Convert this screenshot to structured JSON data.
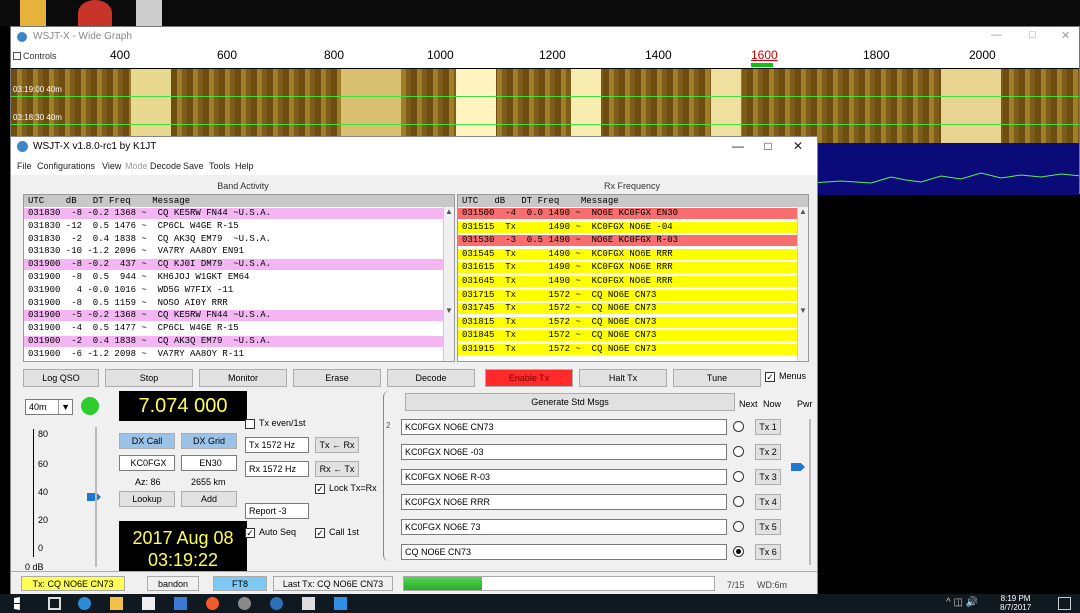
{
  "wide_graph": {
    "title": "WSJT-X - Wide Graph",
    "controls_label": "Controls",
    "scale": [
      "400",
      "600",
      "800",
      "1000",
      "1200",
      "1400",
      "1600",
      "1800",
      "2000"
    ],
    "waterfall_times": [
      "03:19:00 40m",
      "03:18:30 40m"
    ]
  },
  "main": {
    "title": "WSJT-X   v1.8.0-rc1   by K1JT",
    "menu": [
      "File",
      "Configurations",
      "View",
      "Mode",
      "Decode",
      "Save",
      "Tools",
      "Help"
    ],
    "band_activity_label": "Band Activity",
    "rx_frequency_label": "Rx Frequency",
    "band_header": "UTC    dB   DT Freq    Message",
    "rx_header": "UTC   dB   DT Freq    Message",
    "band_rows": [
      {
        "text": "031830  -8 -0.2 1368 ~  CQ KE5RW FN44 ~U.S.A.",
        "hl": "pink"
      },
      {
        "text": "031830 -12  0.5 1476 ~  CP6CL W4GE R-15",
        "hl": ""
      },
      {
        "text": "031830  -2  0.4 1838 ~  CQ AK3Q EM79  ~U.S.A.",
        "hl": ""
      },
      {
        "text": "031830 -10 -1.2 2096 ~  VA7RY AA8OY EN91",
        "hl": ""
      },
      {
        "text": "031900  -8 -0.2  437 ~  CQ KJ0I DM79  ~U.S.A.",
        "hl": "pink"
      },
      {
        "text": "031900  -8  0.5  944 ~  KH6JOJ W1GKT EM64",
        "hl": ""
      },
      {
        "text": "031900   4 -0.0 1016 ~  WD5G W7FIX -11",
        "hl": ""
      },
      {
        "text": "031900  -8  0.5 1159 ~  NOSO AI0Y RRR",
        "hl": ""
      },
      {
        "text": "031900  -5 -0.2 1368 ~  CQ KE5RW FN44 ~U.S.A.",
        "hl": "pink"
      },
      {
        "text": "031900  -4  0.5 1477 ~  CP6CL W4GE R-15",
        "hl": ""
      },
      {
        "text": "031900  -2  0.4 1838 ~  CQ AK3Q EM79  ~U.S.A.",
        "hl": "pink"
      },
      {
        "text": "031900  -6 -1.2 2098 ~  VA7RY AA8OY R-11",
        "hl": ""
      }
    ],
    "rx_rows": [
      {
        "text": "031500  -4  0.0 1490 ~  NO6E KC0FGX EN30",
        "hl": "red"
      },
      {
        "text": "031515  Tx      1490 ~  KC0FGX NO6E -04",
        "hl": "yellow"
      },
      {
        "text": "031530  -3  0.5 1490 ~  NO6E KC0FGX R-03",
        "hl": "red"
      },
      {
        "text": "031545  Tx      1490 ~  KC0FGX NO6E RRR",
        "hl": "yellow"
      },
      {
        "text": "031615  Tx      1490 ~  KC0FGX NO6E RRR",
        "hl": "yellow"
      },
      {
        "text": "031645  Tx      1490 ~  KC0FGX NO6E RRR",
        "hl": "yellow"
      },
      {
        "text": "031715  Tx      1572 ~  CQ NO6E CN73",
        "hl": "yellow"
      },
      {
        "text": "031745  Tx      1572 ~  CQ NO6E CN73",
        "hl": "yellow"
      },
      {
        "text": "031815  Tx      1572 ~  CQ NO6E CN73",
        "hl": "yellow"
      },
      {
        "text": "031845  Tx      1572 ~  CQ NO6E CN73",
        "hl": "yellow"
      },
      {
        "text": "031915  Tx      1572 ~  CQ NO6E CN73",
        "hl": "yellow"
      }
    ],
    "buttons": {
      "log_qso": "Log QSO",
      "stop": "Stop",
      "monitor": "Monitor",
      "erase": "Erase",
      "decode": "Decode",
      "enable_tx": "Enable Tx",
      "halt_tx": "Halt Tx",
      "tune": "Tune",
      "menus": "Menus"
    },
    "band_select": "40m",
    "frequency": "7.074 000",
    "db_scale": [
      "80",
      "60",
      "40",
      "20",
      "0"
    ],
    "db_label": "0 dB",
    "dx_call_btn": "DX Call",
    "dx_grid_btn": "DX Grid",
    "dx_call_val": "KC0FGX",
    "dx_grid_val": "EN30",
    "az": "Az: 86",
    "dist": "2655 km",
    "lookup": "Lookup",
    "add": "Add",
    "date": "2017 Aug 08",
    "time": "03:19:22",
    "tx_even": "Tx even/1st",
    "tx_hz": "Tx  1572  Hz",
    "rx_hz": "Rx  1572  Hz",
    "tx_from_rx": "Tx ← Rx",
    "rx_from_tx": "Rx ← Tx",
    "lock": "Lock Tx=Rx",
    "report": "Report  -3",
    "auto_seq": "Auto Seq",
    "call_1st": "Call 1st",
    "gen_msgs": "Generate Std Msgs",
    "next": "Next",
    "now": "Now",
    "pwr": "Pwr",
    "tx_msgs": [
      "KC0FGX NO6E CN73",
      "KC0FGX NO6E -03",
      "KC0FGX NO6E R-03",
      "KC0FGX NO6E RRR",
      "KC0FGX NO6E 73",
      "CQ NO6E CN73"
    ],
    "tx_btns": [
      "Tx 1",
      "Tx 2",
      "Tx 3",
      "Tx 4",
      "Tx 5",
      "Tx 6"
    ],
    "status": {
      "tx": "Tx: CQ NO6E CN73",
      "band": "bandon",
      "mode": "FT8",
      "last_tx": "Last Tx: CQ NO6E CN73",
      "period": "7/15",
      "wd": "WD:6m"
    }
  },
  "taskbar": {
    "time": "8:19 PM",
    "date": "8/7/2017"
  },
  "colors": {
    "pink": "#f4b6f2",
    "yellow": "#ffff00",
    "red": "#f86d6d",
    "green": "#32cd32",
    "enable_tx_red": "#ff2a2a"
  }
}
